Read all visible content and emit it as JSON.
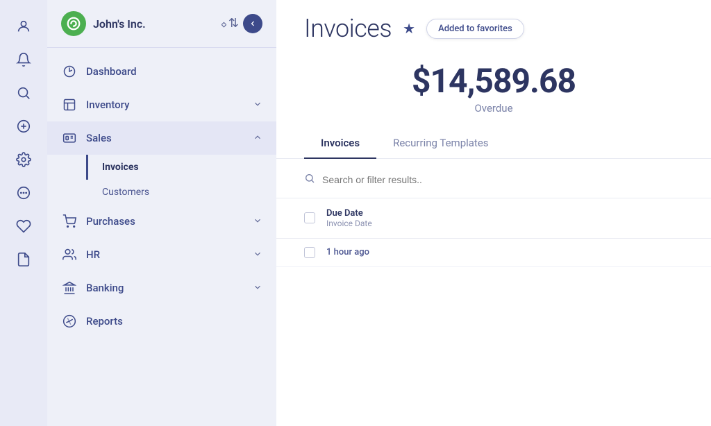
{
  "iconRail": {
    "items": [
      {
        "name": "user-icon",
        "symbol": "👤",
        "active": false
      },
      {
        "name": "bell-icon",
        "symbol": "🔔",
        "active": false
      },
      {
        "name": "search-icon",
        "symbol": "🔍",
        "active": false
      },
      {
        "name": "plus-circle-icon",
        "symbol": "⊕",
        "active": false
      },
      {
        "name": "settings-icon",
        "symbol": "⚙",
        "active": false
      },
      {
        "name": "help-icon",
        "symbol": "◎",
        "active": false
      },
      {
        "name": "heart-icon",
        "symbol": "♡",
        "active": false
      },
      {
        "name": "document-icon",
        "symbol": "📄",
        "active": false
      }
    ]
  },
  "sidebar": {
    "company": "John's Inc.",
    "logo_letter": "a",
    "nav": [
      {
        "id": "dashboard",
        "label": "Dashboard",
        "icon": "dashboard",
        "hasChildren": false,
        "expanded": false
      },
      {
        "id": "inventory",
        "label": "Inventory",
        "icon": "inventory",
        "hasChildren": true,
        "expanded": false
      },
      {
        "id": "sales",
        "label": "Sales",
        "icon": "sales",
        "hasChildren": true,
        "expanded": true,
        "children": [
          {
            "id": "invoices",
            "label": "Invoices",
            "active": true
          },
          {
            "id": "customers",
            "label": "Customers",
            "active": false
          }
        ]
      },
      {
        "id": "purchases",
        "label": "Purchases",
        "icon": "purchases",
        "hasChildren": true,
        "expanded": false
      },
      {
        "id": "hr",
        "label": "HR",
        "icon": "hr",
        "hasChildren": true,
        "expanded": false
      },
      {
        "id": "banking",
        "label": "Banking",
        "icon": "banking",
        "hasChildren": true,
        "expanded": false
      },
      {
        "id": "reports",
        "label": "Reports",
        "icon": "reports",
        "hasChildren": false,
        "expanded": false
      }
    ]
  },
  "main": {
    "title": "Invoices",
    "favorites_badge": "Added to favorites",
    "overdue_amount": "$14,589.68",
    "overdue_label": "Overdue",
    "tabs": [
      {
        "id": "invoices",
        "label": "Invoices",
        "active": true
      },
      {
        "id": "recurring",
        "label": "Recurring Templates",
        "active": false
      }
    ],
    "search_placeholder": "Search or filter results..",
    "table": {
      "col1_primary": "Due Date",
      "col1_secondary": "Invoice Date",
      "recent_row_label": "1 hour ago"
    }
  }
}
